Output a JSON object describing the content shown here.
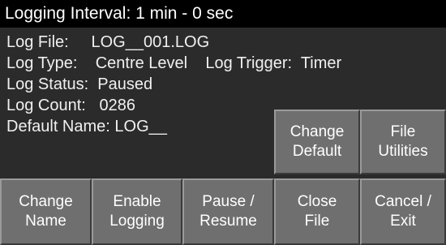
{
  "title": "Logging Interval: 1 min - 0 sec",
  "info": {
    "log_file": "Log File:     LOG__001.LOG",
    "log_type": "Log Type:    Centre Level    Log Trigger:  Timer",
    "log_status": "Log Status:  Paused",
    "log_count": "Log Count:   0286",
    "default_name": "Default Name: LOG__"
  },
  "buttons": {
    "change_default": [
      "Change",
      "Default"
    ],
    "file_utilities": [
      "File",
      "Utilities"
    ],
    "change_name": [
      "Change",
      "Name"
    ],
    "enable_logging": [
      "Enable",
      "Logging"
    ],
    "pause_resume": [
      "Pause /",
      "Resume"
    ],
    "close_file": [
      "Close",
      "File"
    ],
    "cancel_exit": [
      "Cancel /",
      "Exit"
    ]
  },
  "colors": {
    "background": "#2b2b2b",
    "titlebar": "#000000",
    "button": "#6f6f6f",
    "text": "#f2f2f2"
  }
}
